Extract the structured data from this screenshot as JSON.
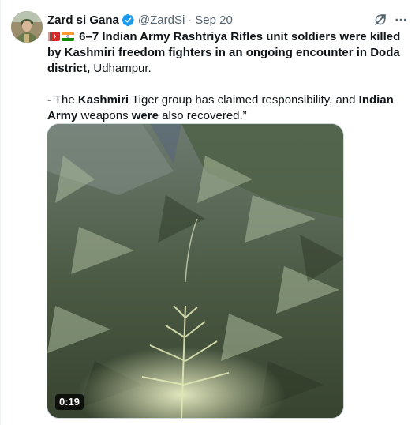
{
  "author": {
    "display_name": "Zard si Gana",
    "handle": "@ZardSi",
    "separator": "·",
    "timestamp": "Sep 20"
  },
  "icons": {
    "verified": "verified-badge-icon",
    "grok": "grok-icon",
    "more": "more-options-icon",
    "flag1": "kashmir-flag-icon",
    "flag2": "india-flag-icon"
  },
  "tweet": {
    "p1_bold": "6–7 Indian Army Rashtriya Rifles unit soldiers were killed by Kashmiri freedom fighters in an ongoing encounter in Doda district,",
    "p1_rest": " Udhampur.",
    "p2_a": "- The ",
    "p2_b": "Kashmiri",
    "p2_c": " Tiger group has claimed responsibility, and ",
    "p2_d": "Indian Army",
    "p2_e": " weapons ",
    "p2_f": "were",
    "p2_g": " also recovered.”"
  },
  "media": {
    "type": "video",
    "duration": "0:19"
  },
  "colors": {
    "text": "#0f1419",
    "secondary": "#536471",
    "verified": "#1d9bf0"
  }
}
